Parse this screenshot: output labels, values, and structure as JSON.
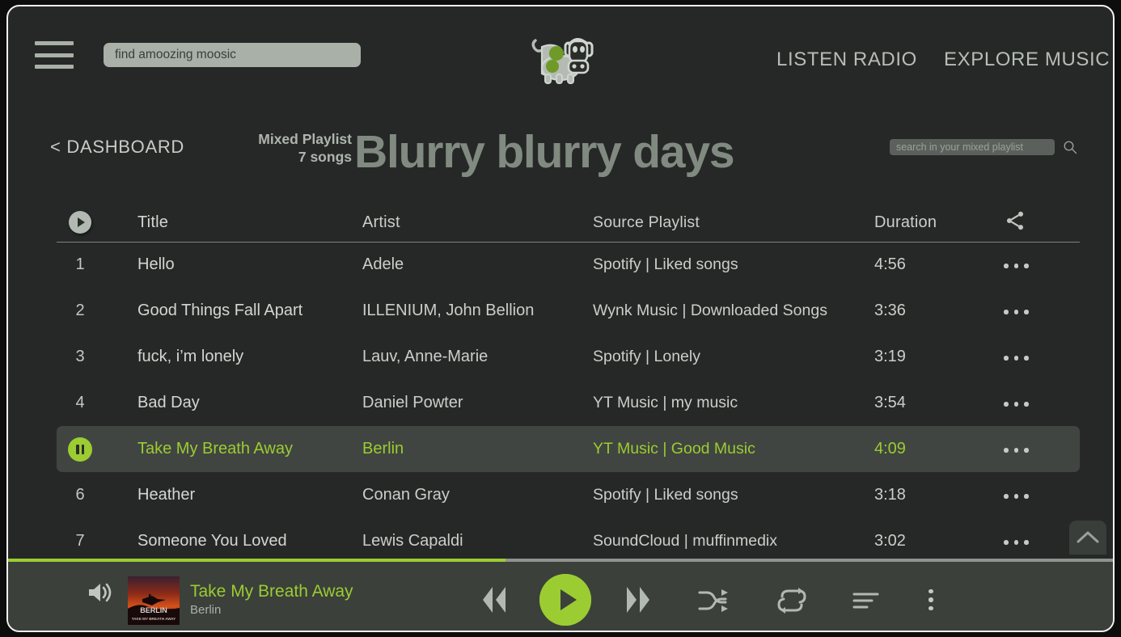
{
  "header": {
    "menu_icon": "hamburger-icon",
    "search_placeholder": "find amoozing moosic",
    "search_value": "",
    "logo_icon": "cow-with-headphones-logo",
    "nav": [
      {
        "label": "LISTEN RADIO"
      },
      {
        "label": "EXPLORE MUSIC"
      }
    ]
  },
  "page": {
    "back_label": "< DASHBOARD",
    "playlist_kind": "Mixed Playlist",
    "song_count": "7 songs",
    "title": "Blurry blurry days",
    "search_placeholder": "search in your mixed playlist",
    "search_value": "",
    "search_icon": "search-icon"
  },
  "table": {
    "play_all_icon": "play-icon",
    "share_icon": "share-icon",
    "columns": {
      "title": "Title",
      "artist": "Artist",
      "source": "Source Playlist",
      "duration": "Duration"
    },
    "more_icon": "more-horizontal-icon",
    "rows": [
      {
        "index": "1",
        "title": "Hello",
        "artist": "Adele",
        "source": "Spotify | Liked songs",
        "duration": "4:56",
        "playing": false
      },
      {
        "index": "2",
        "title": "Good Things Fall Apart",
        "artist": "ILLENIUM, John Bellion",
        "source": "Wynk Music | Downloaded Songs",
        "duration": "3:36",
        "playing": false
      },
      {
        "index": "3",
        "title": "fuck, i’m lonely",
        "artist": "Lauv, Anne-Marie",
        "source": "Spotify | Lonely",
        "duration": "3:19",
        "playing": false
      },
      {
        "index": "4",
        "title": "Bad Day",
        "artist": "Daniel Powter",
        "source": "YT Music | my music",
        "duration": "3:54",
        "playing": false
      },
      {
        "index": "5",
        "title": "Take My Breath Away",
        "artist": "Berlin",
        "source": "YT Music | Good Music",
        "duration": "4:09",
        "playing": true
      },
      {
        "index": "6",
        "title": "Heather",
        "artist": "Conan Gray",
        "source": "Spotify | Liked songs",
        "duration": "3:18",
        "playing": false
      },
      {
        "index": "7",
        "title": "Someone You Loved",
        "artist": "Lewis Capaldi",
        "source": "SoundCloud | muffinmedix",
        "duration": "3:02",
        "playing": false
      }
    ]
  },
  "scroll_top": {
    "icon": "chevron-up-icon"
  },
  "player": {
    "progress_percent": 45,
    "volume_icon": "volume-icon",
    "album_art_title": "BERLIN",
    "album_art_subtitle": "TAKE MY BREATH AWAY",
    "now_playing_title": "Take My Breath Away",
    "now_playing_artist": "Berlin",
    "controls": {
      "previous": "rewind-icon",
      "play": "play-icon",
      "next": "fast-forward-icon",
      "shuffle": "shuffle-icon",
      "repeat": "repeat-icon",
      "queue": "queue-list-icon",
      "more": "more-vertical-icon"
    }
  },
  "colors": {
    "accent_green": "#9bcc31",
    "window_bg": "#262827",
    "player_bg": "#3b403b",
    "active_row_bg": "#414541",
    "text_primary": "#d2d7d2",
    "text_muted": "#8d948d",
    "search_bg": "#a8b0a8"
  }
}
